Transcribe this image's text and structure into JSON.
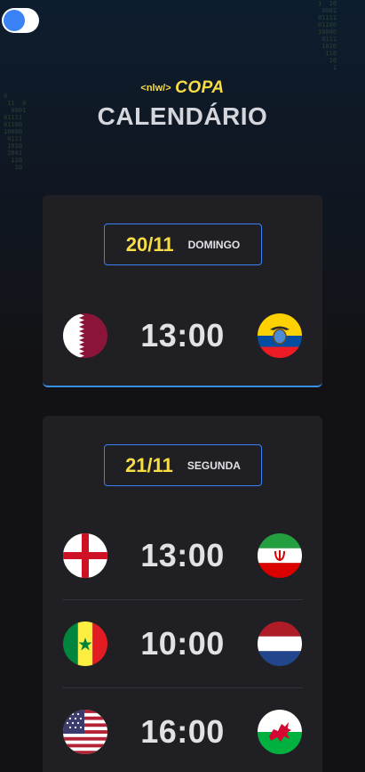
{
  "header": {
    "logo_tag": "<nlw/>",
    "logo_word": "COPA",
    "title": "CALENDÁRIO"
  },
  "theme_toggle": {
    "state": "dark"
  },
  "colors": {
    "accent": "#3b82f6",
    "highlight": "#f7dd43",
    "card": "#202024",
    "background": "#121214"
  },
  "binary_left": "0\n 11  0\n  0001\n01111\n01100\n10000\n 0111\n 1010\n 2081\n  110\n   10",
  "binary_right": "1  10\n 0001\n01111\n01100\n10000\n 0111\n 1010\n  110\n   10\n    1",
  "days": [
    {
      "date": "20/11",
      "weekday": "DOMINGO",
      "matches": [
        {
          "home_flag": "qatar-flag-icon",
          "time": "13:00",
          "away_flag": "ecuador-flag-icon"
        }
      ]
    },
    {
      "date": "21/11",
      "weekday": "SEGUNDA",
      "matches": [
        {
          "home_flag": "england-flag-icon",
          "time": "13:00",
          "away_flag": "iran-flag-icon"
        },
        {
          "home_flag": "senegal-flag-icon",
          "time": "10:00",
          "away_flag": "netherlands-flag-icon"
        },
        {
          "home_flag": "usa-flag-icon",
          "time": "16:00",
          "away_flag": "wales-flag-icon"
        }
      ]
    }
  ]
}
